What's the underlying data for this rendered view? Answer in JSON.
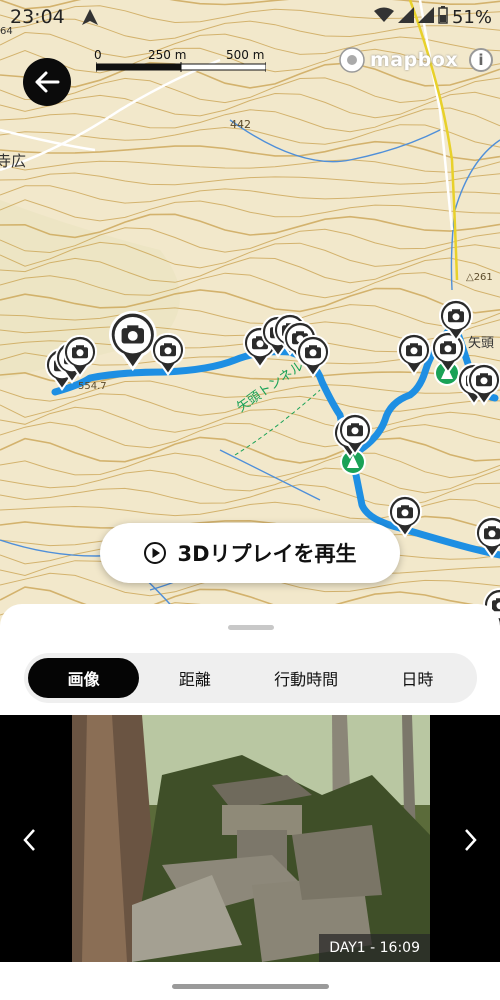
{
  "status_bar": {
    "time": "23:04",
    "battery": "51%"
  },
  "map": {
    "scale_labels": [
      "0",
      "250 m",
      "500 m"
    ],
    "attribution": "mapbox",
    "info_label": "i",
    "place_labels": {
      "elev_442": "442",
      "elev_554": "554.7",
      "elev_261": "△261",
      "place_a": "寺広",
      "tunnel": "矢頭トンネル",
      "mountain": "矢頭",
      "corner": "64"
    },
    "colors": {
      "route": "#1e8fe3",
      "contour": "#c9a14e",
      "road_yellow": "#e8d12a",
      "start_marker": "#1aa257"
    }
  },
  "replay_button": {
    "icon": "play-circle-icon",
    "label": "3Dリプレイを再生"
  },
  "sheet": {
    "tabs": [
      {
        "label": "画像",
        "active": true
      },
      {
        "label": "距離",
        "active": false
      },
      {
        "label": "行動時間",
        "active": false
      },
      {
        "label": "日時",
        "active": false
      }
    ],
    "photo_caption": "DAY1 - 16:09"
  }
}
